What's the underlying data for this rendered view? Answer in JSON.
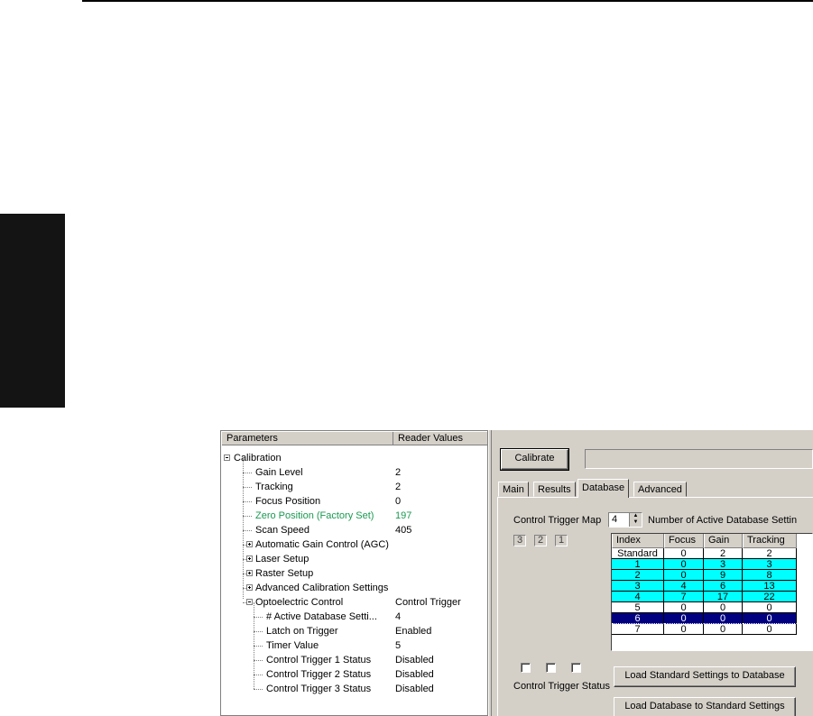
{
  "tree": {
    "columns": [
      "Parameters",
      "Reader Values"
    ],
    "rows": [
      {
        "label": "Calibration",
        "value": "",
        "level": 0,
        "expander": "minus"
      },
      {
        "label": "Gain Level",
        "value": "2",
        "level": 1
      },
      {
        "label": "Tracking",
        "value": "2",
        "level": 1
      },
      {
        "label": "Focus Position",
        "value": "0",
        "level": 1
      },
      {
        "label": "Zero Position (Factory Set)",
        "value": "197",
        "level": 1,
        "highlight": true
      },
      {
        "label": "Scan Speed",
        "value": "405",
        "level": 1
      },
      {
        "label": "Automatic Gain Control (AGC)",
        "value": "",
        "level": 1,
        "expander": "plus"
      },
      {
        "label": "Laser Setup",
        "value": "",
        "level": 1,
        "expander": "plus"
      },
      {
        "label": "Raster Setup",
        "value": "",
        "level": 1,
        "expander": "plus"
      },
      {
        "label": "Advanced Calibration Settings",
        "value": "",
        "level": 1,
        "expander": "plus"
      },
      {
        "label": "Optoelectric Control",
        "value": "Control Trigger",
        "level": 1,
        "expander": "minus"
      },
      {
        "label": "# Active Database Setti...",
        "value": "4",
        "level": 2
      },
      {
        "label": "Latch on Trigger",
        "value": "Enabled",
        "level": 2
      },
      {
        "label": "Timer Value",
        "value": "5",
        "level": 2
      },
      {
        "label": "Control Trigger 1 Status",
        "value": "Disabled",
        "level": 2
      },
      {
        "label": "Control Trigger 2 Status",
        "value": "Disabled",
        "level": 2
      },
      {
        "label": "Control Trigger 3 Status",
        "value": "Disabled",
        "level": 2
      }
    ]
  },
  "right": {
    "calibrate_label": "Calibrate",
    "tabs": [
      "Main",
      "Results",
      "Database",
      "Advanced"
    ],
    "active_tab": "Database",
    "control_trigger_map_label": "Control Trigger Map",
    "spin_value": "4",
    "active_settings_label": "Number of Active Database Settin",
    "trigger_boxes": [
      "3",
      "2",
      "1"
    ],
    "control_trigger_status_label": "Control Trigger Status",
    "load_standard_label": "Load Standard Settings to Database",
    "load_database_label": "Load Database to Standard Settings",
    "table": {
      "columns": [
        "Index",
        "Focus",
        "Gain",
        "Tracking"
      ],
      "rows": [
        {
          "cells": [
            "Standard",
            "0",
            "2",
            "2"
          ],
          "style": "white"
        },
        {
          "cells": [
            "1",
            "0",
            "3",
            "3"
          ],
          "style": "cyan"
        },
        {
          "cells": [
            "2",
            "0",
            "9",
            "8"
          ],
          "style": "cyan"
        },
        {
          "cells": [
            "3",
            "4",
            "6",
            "13"
          ],
          "style": "cyan"
        },
        {
          "cells": [
            "4",
            "7",
            "17",
            "22"
          ],
          "style": "cyan"
        },
        {
          "cells": [
            "5",
            "0",
            "0",
            "0"
          ],
          "style": "white"
        },
        {
          "cells": [
            "6",
            "0",
            "0",
            "0"
          ],
          "style": "selected"
        },
        {
          "cells": [
            "7",
            "0",
            "0",
            "0"
          ],
          "style": "white"
        }
      ]
    }
  },
  "colors": {
    "cyan_row": "#00ffff",
    "selected_row": "#000080",
    "highlight_text": "#1a9a52",
    "panel_bg": "#d4d0c8"
  }
}
